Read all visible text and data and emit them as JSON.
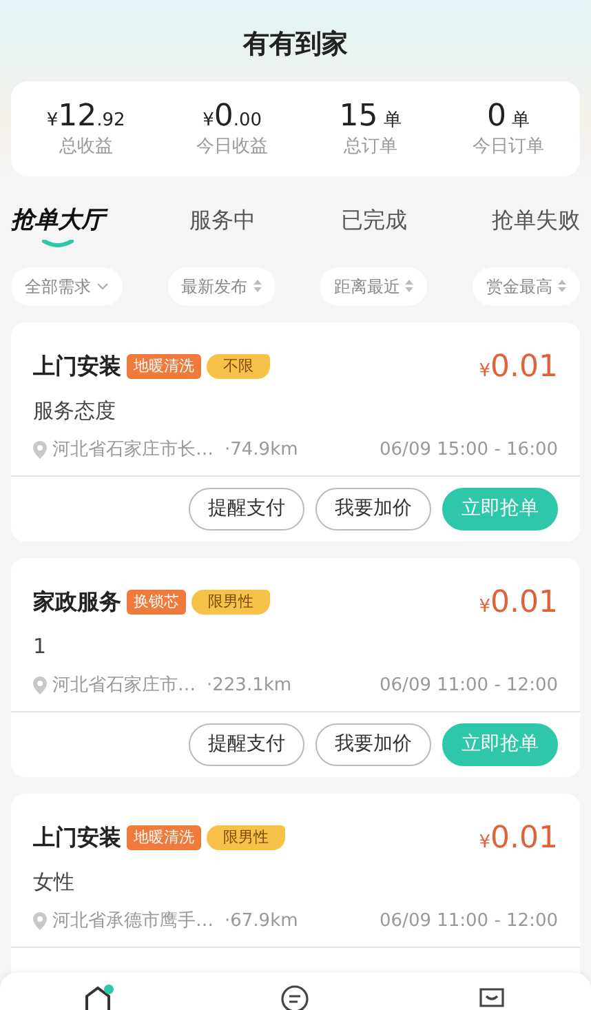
{
  "header": {
    "title": "有有到家"
  },
  "stats": [
    {
      "prefix": "¥",
      "main": "12",
      "suffix": ".92",
      "label": "总收益"
    },
    {
      "prefix": "¥",
      "main": "0",
      "suffix": ".00",
      "label": "今日收益"
    },
    {
      "main": "15",
      "suffix": "单",
      "label": "总订单"
    },
    {
      "main": "0",
      "suffix": "单",
      "label": "今日订单"
    }
  ],
  "tabs": [
    {
      "label": "抢单大厅",
      "selected": true
    },
    {
      "label": "服务中",
      "selected": false
    },
    {
      "label": "已完成",
      "selected": false
    },
    {
      "label": "抢单失败",
      "selected": false
    }
  ],
  "filters": [
    {
      "label": "全部需求",
      "kind": "dropdown"
    },
    {
      "label": "最新发布",
      "kind": "sort"
    },
    {
      "label": "距离最近",
      "kind": "sort"
    },
    {
      "label": "赏金最高",
      "kind": "sort"
    }
  ],
  "orders": [
    {
      "title": "上门安装",
      "tags": [
        {
          "text": "地暖清洗",
          "color": "#f07a3c"
        },
        {
          "text": "不限",
          "color": "#f8c24a"
        }
      ],
      "price_symbol": "¥",
      "price": "0.01",
      "note": "服务态度",
      "address": "河北省石家庄市长…",
      "distance": "·74.9km",
      "time": "06/09 15:00 - 16:00",
      "buttons": [
        {
          "label": "提醒支付",
          "kind": "outline"
        },
        {
          "label": "我要加价",
          "kind": "outline"
        },
        {
          "label": "立即抢单",
          "kind": "primary"
        }
      ]
    },
    {
      "title": "家政服务",
      "tags": [
        {
          "text": "换锁芯",
          "color": "#f07a3c"
        },
        {
          "text": "限男性",
          "color": "#f8c24a"
        }
      ],
      "price_symbol": "¥",
      "price": "0.01",
      "note": "1",
      "address": "河北省石家庄市…",
      "distance": "·223.1km",
      "time": "06/09 11:00 - 12:00",
      "buttons": [
        {
          "label": "提醒支付",
          "kind": "outline"
        },
        {
          "label": "我要加价",
          "kind": "outline"
        },
        {
          "label": "立即抢单",
          "kind": "primary"
        }
      ]
    },
    {
      "title": "上门安装",
      "tags": [
        {
          "text": "地暖清洗",
          "color": "#f07a3c"
        },
        {
          "text": "限男性",
          "color": "#f8c24a"
        }
      ],
      "price_symbol": "¥",
      "price": "0.01",
      "note": "女性",
      "address": "河北省承德市鹰手…",
      "distance": "·67.9km",
      "time": "06/09 11:00 - 12:00"
    }
  ],
  "bottom_nav": [
    {
      "kind": "home",
      "selected": true
    },
    {
      "kind": "message",
      "selected": false
    },
    {
      "kind": "profile",
      "selected": false
    }
  ]
}
